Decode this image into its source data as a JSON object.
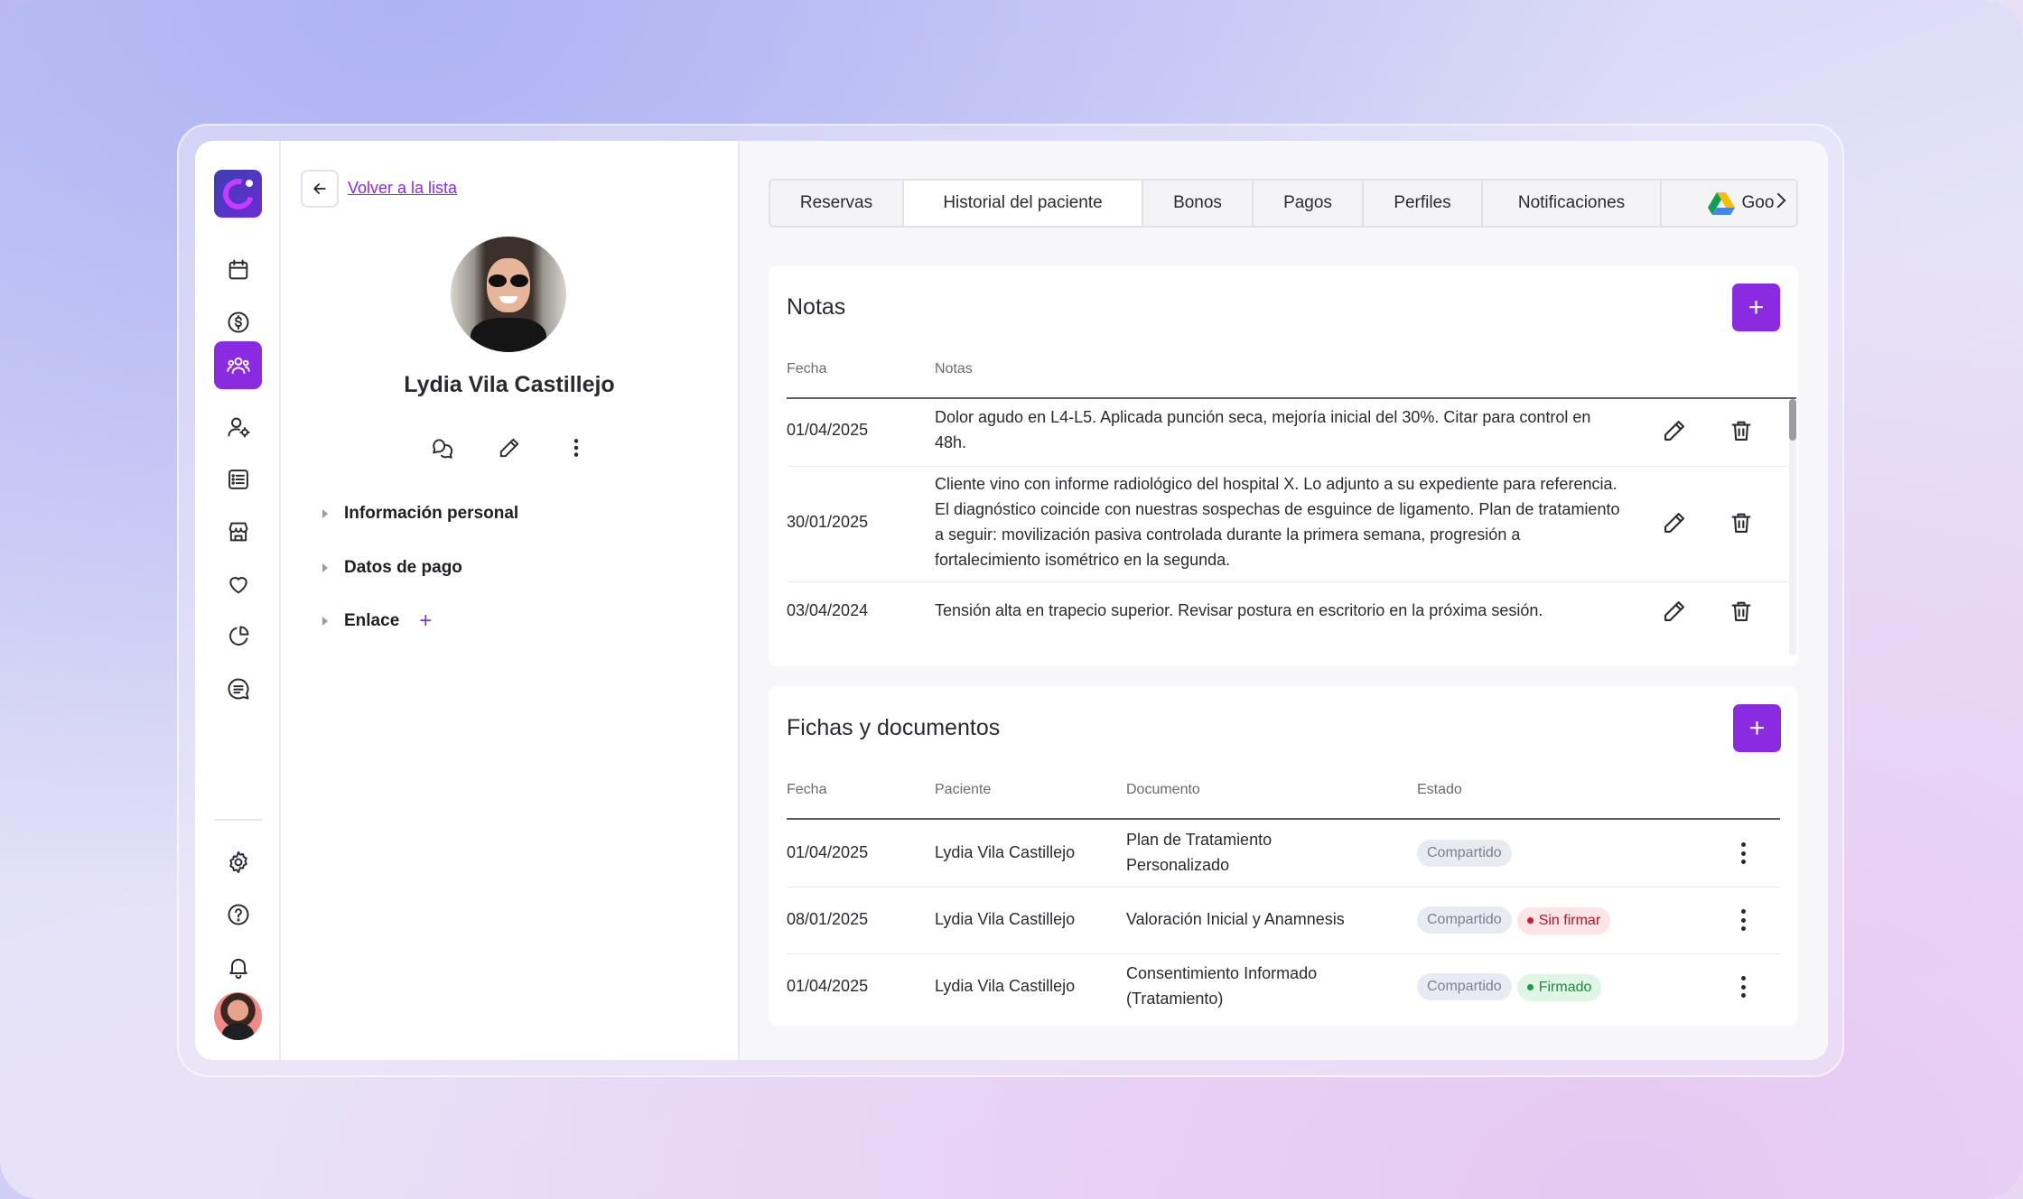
{
  "back": {
    "link_label": "Volver a la lista"
  },
  "patient": {
    "name": "Lydia Vila Castillejo"
  },
  "accordion": [
    {
      "label": "Información personal"
    },
    {
      "label": "Datos de pago"
    },
    {
      "label": "Enlace"
    }
  ],
  "tabs": [
    {
      "label": "Reservas"
    },
    {
      "label": "Historial del paciente",
      "active": true
    },
    {
      "label": "Bonos"
    },
    {
      "label": "Pagos"
    },
    {
      "label": "Perfiles"
    },
    {
      "label": "Notificaciones"
    },
    {
      "label": "Goo"
    }
  ],
  "notes": {
    "title": "Notas",
    "add_label": "+",
    "headers": {
      "date": "Fecha",
      "notes": "Notas"
    },
    "rows": [
      {
        "date": "01/04/2025",
        "text": "Dolor agudo en L4-L5. Aplicada punción seca, mejoría inicial del 30%. Citar para control en 48h."
      },
      {
        "date": "30/01/2025",
        "text": "Cliente vino con informe radiológico del hospital X. Lo adjunto a su expediente para referencia. El diagnóstico coincide con nuestras sospechas de esguince de ligamento. Plan de tratamiento a seguir: movilización pasiva controlada durante la primera semana, progresión a fortalecimiento isométrico en la segunda."
      },
      {
        "date": "03/04/2024",
        "text": "Tensión alta en trapecio superior. Revisar postura en escritorio en la próxima sesión."
      }
    ]
  },
  "documents": {
    "title": "Fichas y documentos",
    "add_label": "+",
    "headers": {
      "date": "Fecha",
      "patient": "Paciente",
      "document": "Documento",
      "status": "Estado"
    },
    "rows": [
      {
        "date": "01/04/2025",
        "patient": "Lydia Vila Castillejo",
        "document": "Plan de Tratamiento Personalizado",
        "shared": "Compartido",
        "sign": ""
      },
      {
        "date": "08/01/2025",
        "patient": "Lydia Vila Castillejo",
        "document": "Valoración Inicial y Anamnesis",
        "shared": "Compartido",
        "sign": "Sin firmar"
      },
      {
        "date": "01/04/2025",
        "patient": "Lydia Vila Castillejo",
        "document": "Consentimiento Informado (Tratamiento)",
        "shared": "Compartido",
        "sign": "Firmado"
      }
    ]
  },
  "colors": {
    "accent": "#8a2be2",
    "unsigned": "#d11a33",
    "signed": "#1f9a45"
  },
  "icons": [
    "calendar-icon",
    "dollar-icon",
    "users-icon",
    "user-settings-icon",
    "list-icon",
    "store-icon",
    "heart-icon",
    "pie-chart-icon",
    "message-lines-icon",
    "gear-icon",
    "help-icon",
    "bell-icon"
  ]
}
